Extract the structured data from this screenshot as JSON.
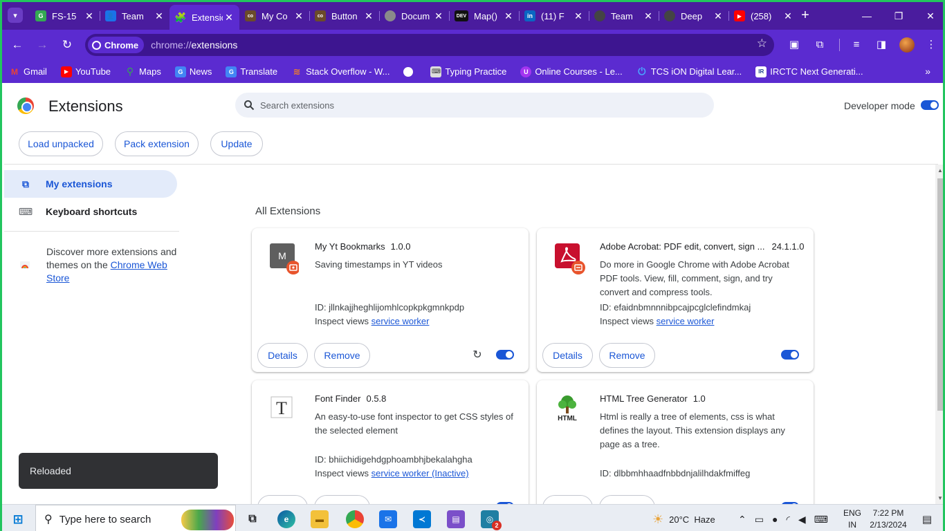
{
  "browser": {
    "tabs": [
      {
        "title": "FS-15",
        "icon": "google-classroom-icon",
        "color": "#34a853"
      },
      {
        "title": "Team",
        "icon": "teams-user-icon",
        "color": "#1a73e8"
      },
      {
        "title": "Extensions",
        "icon": "puzzle-icon",
        "color": "#5b2bd0"
      },
      {
        "title": "My Co",
        "icon": "codepen-icon",
        "color": "#6b4b2a"
      },
      {
        "title": "Button",
        "icon": "codepen-icon",
        "color": "#6b4b2a"
      },
      {
        "title": "Docum",
        "icon": "globe-icon",
        "color": "#8a8a8a"
      },
      {
        "title": "Map()",
        "icon": "dev-icon",
        "color": "#111111"
      },
      {
        "title": "(11) F",
        "icon": "linkedin-icon",
        "color": "#0a66c2"
      },
      {
        "title": "Team",
        "icon": "github-icon",
        "color": "#444444"
      },
      {
        "title": "Deep",
        "icon": "github-icon",
        "color": "#444444"
      },
      {
        "title": "(258)",
        "icon": "youtube-icon",
        "color": "#ff0000"
      }
    ],
    "active_tab_index": 2,
    "omnibox": {
      "chip_label": "Chrome",
      "url_scheme": "chrome://",
      "url_path": "extensions"
    },
    "bookmarks": [
      {
        "label": "Gmail",
        "icon": "gmail-icon",
        "color": "#ea4335"
      },
      {
        "label": "YouTube",
        "icon": "youtube-icon",
        "color": "#ff0000"
      },
      {
        "label": "Maps",
        "icon": "maps-pin-icon",
        "color": "#34a853"
      },
      {
        "label": "News",
        "icon": "news-icon",
        "color": "#4285f4"
      },
      {
        "label": "Translate",
        "icon": "translate-icon",
        "color": "#4285f4"
      },
      {
        "label": "Stack Overflow - W...",
        "icon": "stackoverflow-icon",
        "color": "#f48024"
      },
      {
        "label": "",
        "icon": "globe-icon",
        "color": "#ffffff"
      },
      {
        "label": "Typing Practice",
        "icon": "keyboard-icon",
        "color": "#dddddd"
      },
      {
        "label": "Online Courses - Le...",
        "icon": "udemy-icon",
        "color": "#a435f0"
      },
      {
        "label": "TCS iON Digital Lear...",
        "icon": "tcs-ion-icon",
        "color": "#1a73e8"
      },
      {
        "label": "IRCTC Next Generati...",
        "icon": "irctc-icon",
        "color": "#ffffff"
      }
    ]
  },
  "page": {
    "title": "Extensions",
    "search_placeholder": "Search extensions",
    "developer_mode_label": "Developer mode",
    "developer_mode_on": true,
    "actions": [
      "Load unpacked",
      "Pack extension",
      "Update"
    ],
    "sidebar": {
      "items": [
        {
          "label": "My extensions",
          "icon": "extension-icon",
          "active": true
        },
        {
          "label": "Keyboard shortcuts",
          "icon": "keyboard-icon",
          "active": false
        }
      ],
      "discover_text": "Discover more extensions and themes on the ",
      "store_link": "Chrome Web Store"
    },
    "section_title": "All Extensions",
    "extensions": [
      {
        "name": "My Yt Bookmarks",
        "version": "1.0.0",
        "description": "Saving timestamps in YT videos",
        "id_label": "ID: jllnkajjheghlijomhlcopkpkgmnkpdp",
        "inspect_label": "Inspect views ",
        "inspect_link": "service worker",
        "details_label": "Details",
        "remove_label": "Remove",
        "enabled": true,
        "show_reload": true,
        "icon": "m-letter-icon"
      },
      {
        "name": "Adobe Acrobat: PDF edit, convert, sign ...",
        "version": "24.1.1.0",
        "description": "Do more in Google Chrome with Adobe Acrobat PDF tools. View, fill, comment, sign, and try convert and compress tools.",
        "id_label": "ID: efaidnbmnnnibpcajpcglclefindmkaj",
        "inspect_label": "Inspect views ",
        "inspect_link": "service worker",
        "details_label": "Details",
        "remove_label": "Remove",
        "enabled": true,
        "show_reload": false,
        "icon": "adobe-acrobat-icon"
      },
      {
        "name": "Font Finder",
        "version": "0.5.8",
        "description": "An easy-to-use font inspector to get CSS styles of the selected element",
        "id_label": "ID: bhiichidigehdgphoambhjbekalahgha",
        "inspect_label": "Inspect views ",
        "inspect_link": "service worker (Inactive)",
        "details_label": "Details",
        "remove_label": "Remove",
        "enabled": true,
        "show_reload": false,
        "icon": "font-t-icon"
      },
      {
        "name": "HTML Tree Generator",
        "version": "1.0",
        "description": "Html is really a tree of elements, css is what defines the layout. This extension displays any page as a tree.",
        "id_label": "ID: dlbbmhhaadfnbbdnjalilhdakfmiffeg",
        "inspect_label": "",
        "inspect_link": "",
        "details_label": "Details",
        "remove_label": "Remove",
        "enabled": true,
        "show_reload": false,
        "icon": "html-tree-icon"
      }
    ],
    "toast": "Reloaded"
  },
  "taskbar": {
    "search_placeholder": "Type here to search",
    "weather": "20°C  Haze",
    "language": [
      "ENG",
      "IN"
    ],
    "time": "7:22 PM",
    "date": "2/13/2024",
    "badge_count": "2"
  },
  "colors": {
    "accent": "#1a56d6",
    "browser_frame": "#5b2bd0",
    "tabstrip": "#4a1c9e",
    "window_border": "#22c55e"
  }
}
